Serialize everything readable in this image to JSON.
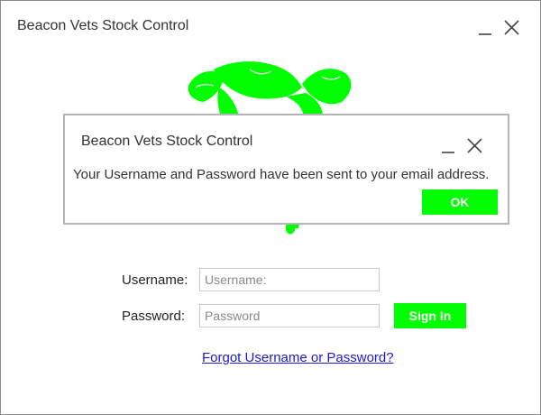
{
  "window": {
    "title": "Beacon Vets Stock Control",
    "minimize_icon": "minimize-icon",
    "close_icon": "close-icon"
  },
  "logo": {
    "icon": "cow-logo-icon",
    "color": "#00ff00"
  },
  "form": {
    "username_label": "Username:",
    "username_placeholder": "Username:",
    "username_value": "",
    "password_label": "Password:",
    "password_placeholder": "Password",
    "password_value": "",
    "sign_in_label": "Sign In",
    "forgot_link": "Forgot Username or Password?"
  },
  "dialog": {
    "title": "Beacon Vets Stock Control",
    "message": "Your Username and Password have been sent to your email address.",
    "ok_label": "OK"
  },
  "colors": {
    "accent": "#00ff00",
    "link": "#1a1ad8",
    "button_text": "#ffffff"
  }
}
